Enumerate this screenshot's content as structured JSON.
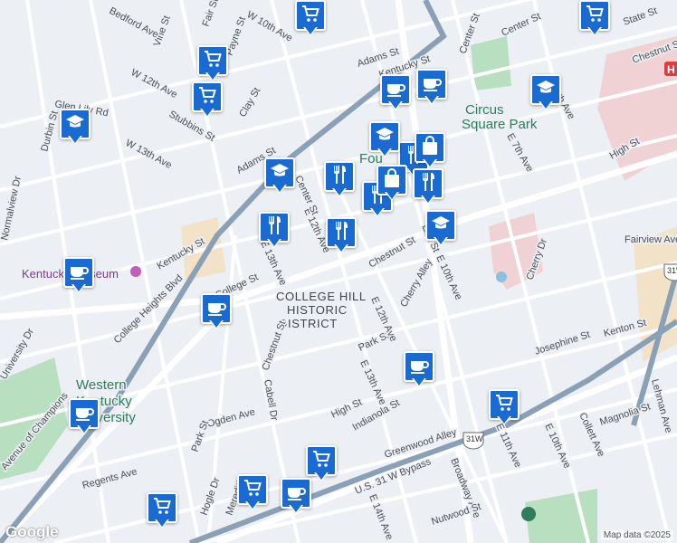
{
  "map": {
    "attribution": "Map data ©2025",
    "logo": "Google",
    "district_label": [
      "COLLEGE HILL",
      "HISTORIC",
      "DISTRICT"
    ],
    "places": {
      "park": [
        "Circus",
        "Square Park"
      ],
      "university": [
        "Western",
        "Kentucky",
        "University"
      ],
      "museum": "Kentucky Museum",
      "fountain_partial": "Fou"
    },
    "hospital_icon": "hospital-icon",
    "route_shields": [
      "31W",
      "31W"
    ],
    "street_labels": [
      "Adams St",
      "Kentucky St",
      "Center St",
      "E 12th Ave",
      "E 13th Ave",
      "Chestnut St",
      "College St",
      "Park St",
      "High St",
      "E 10th Ave",
      "Cherry Alley",
      "Elm St",
      "Cherry Dr",
      "Fairview Ave",
      "Kenton St",
      "Josephine St",
      "Lehman Ave",
      "E 11th Ave",
      "E 10th Ave",
      "Collett Ave",
      "Magnolia St",
      "Broadway Ave",
      "Greenwood Alley",
      "U.S. 31 W Bypass",
      "Nutwood St",
      "E 14th Ave",
      "Indianola St",
      "Ogden Ave",
      "Regents Ave",
      "Park St",
      "Hogle Dr",
      "Meredith",
      "Cabell Dr",
      "College Heights Blvd",
      "E 13th Ave",
      "W 13th Ave",
      "W 12th Ave",
      "Stubbins St",
      "Clay St",
      "Durbin St",
      "Glen Lily Rd",
      "Normalview Dr",
      "University Dr",
      "Avenue of Champions",
      "Vine St",
      "Fair St",
      "W 10th Ave",
      "Payne St",
      "Bedford Ave",
      "State St",
      "E 4th Ave",
      "E 7th Ave",
      "High St",
      "Chestnut St",
      "Chestnut St",
      "E 12th Ave",
      "Kentucky St",
      "Center St",
      "Center St",
      "Adams St"
    ],
    "markers": [
      {
        "type": "shopping-cart"
      },
      {
        "type": "shopping-cart"
      },
      {
        "type": "shopping-cart"
      },
      {
        "type": "school"
      },
      {
        "type": "school"
      },
      {
        "type": "school"
      },
      {
        "type": "school"
      },
      {
        "type": "cafe"
      },
      {
        "type": "cafe"
      },
      {
        "type": "cafe"
      },
      {
        "type": "cafe"
      },
      {
        "type": "cafe"
      },
      {
        "type": "cafe"
      },
      {
        "type": "restaurant"
      },
      {
        "type": "restaurant"
      },
      {
        "type": "restaurant"
      },
      {
        "type": "restaurant"
      },
      {
        "type": "restaurant"
      },
      {
        "type": "restaurant"
      },
      {
        "type": "shopping-bag"
      },
      {
        "type": "shopping-bag"
      },
      {
        "type": "shopping-cart"
      },
      {
        "type": "shopping-cart"
      },
      {
        "type": "shopping-cart"
      },
      {
        "type": "shopping-cart"
      },
      {
        "type": "shopping-cart"
      },
      {
        "type": "cafe"
      },
      {
        "type": "school"
      }
    ],
    "colors": {
      "land": "#eceff3",
      "road": "#ffffff",
      "highway": "#8aa0b6",
      "park": "#b9dfc1",
      "campus": "#f2e3c8",
      "marker": "#1a6bd1",
      "hospital": "#f4c6c6"
    }
  }
}
